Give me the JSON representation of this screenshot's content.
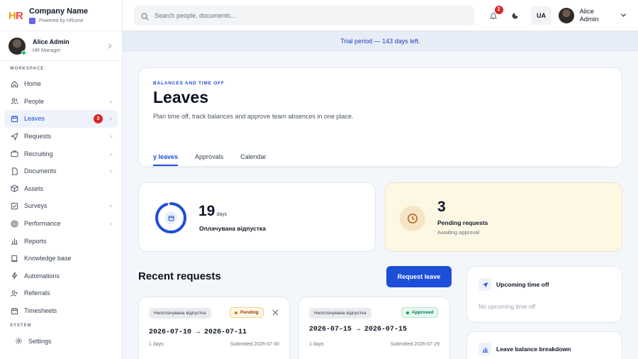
{
  "brand": {
    "name": "Company Name",
    "powered_by": "Powered by HRume"
  },
  "user": {
    "name": "Alice Admin",
    "role": "HR Manager"
  },
  "sidebar": {
    "workspace_label": "WORKSPACE",
    "items": [
      {
        "label": "Home",
        "icon": "home-icon",
        "chevron": false
      },
      {
        "label": "People",
        "icon": "people-icon",
        "chevron": true
      },
      {
        "label": "Leaves",
        "icon": "calendar-icon",
        "chevron": true,
        "badge": "3",
        "active": true
      },
      {
        "label": "Requests",
        "icon": "send-icon",
        "chevron": true
      },
      {
        "label": "Recruiting",
        "icon": "briefcase-icon",
        "chevron": true
      },
      {
        "label": "Documents",
        "icon": "document-icon",
        "chevron": true
      },
      {
        "label": "Assets",
        "icon": "box-icon",
        "chevron": false
      },
      {
        "label": "Surveys",
        "icon": "checkbox-icon",
        "chevron": true
      },
      {
        "label": "Performance",
        "icon": "target-icon",
        "chevron": true
      },
      {
        "label": "Reports",
        "icon": "bar-chart-icon",
        "chevron": false
      },
      {
        "label": "Knowledge base",
        "icon": "book-icon",
        "chevron": false
      },
      {
        "label": "Automations",
        "icon": "bolt-icon",
        "chevron": false
      },
      {
        "label": "Referrals",
        "icon": "users-icon",
        "chevron": false
      },
      {
        "label": "Timesheets",
        "icon": "calendar-grid-icon",
        "chevron": false
      }
    ],
    "system_label": "SYSTEM",
    "settings_label": "Settings"
  },
  "topbar": {
    "search_placeholder": "Search people, documents...",
    "notification_count": "2",
    "language": "UA",
    "user_name": "Alice Admin"
  },
  "trial_banner": "Trial period — 143 days left.",
  "header": {
    "eyebrow": "BALANCES AND TIME OFF",
    "title": "Leaves",
    "subtitle": "Plan time off, track balances and approve team absences in one place.",
    "tabs": [
      {
        "label": "y leaves",
        "active": true
      },
      {
        "label": "Approvals",
        "active": false
      },
      {
        "label": "Calendar",
        "active": false
      }
    ]
  },
  "balance": {
    "value": "19",
    "unit": "days",
    "label": "Оплачувана відпустка",
    "ring_fraction": 0.95
  },
  "pending": {
    "value": "3",
    "label": "Pending requests",
    "sub": "Awaiting approval"
  },
  "recent": {
    "title": "Recent requests",
    "request_button": "Request leave",
    "items": [
      {
        "type": "Неоплачувана відпустка",
        "status": "Pending",
        "dates": "2026-07-10 → 2026-07-11",
        "days": "1 days",
        "submitted": "Submitted 2026-07-30"
      },
      {
        "type": "Неоплачувана відпустка",
        "status": "Approved",
        "dates": "2026-07-15 → 2026-07-15",
        "days": "1 days",
        "submitted": "Submitted 2026-07-29"
      }
    ]
  },
  "upcoming": {
    "title": "Upcoming time off",
    "empty": "No upcoming time off"
  },
  "breakdown": {
    "title": "Leave balance breakdown"
  },
  "colors": {
    "accent": "#1d4ed8",
    "badge": "#dc2626",
    "pending_bg": "#fdf8e4"
  }
}
